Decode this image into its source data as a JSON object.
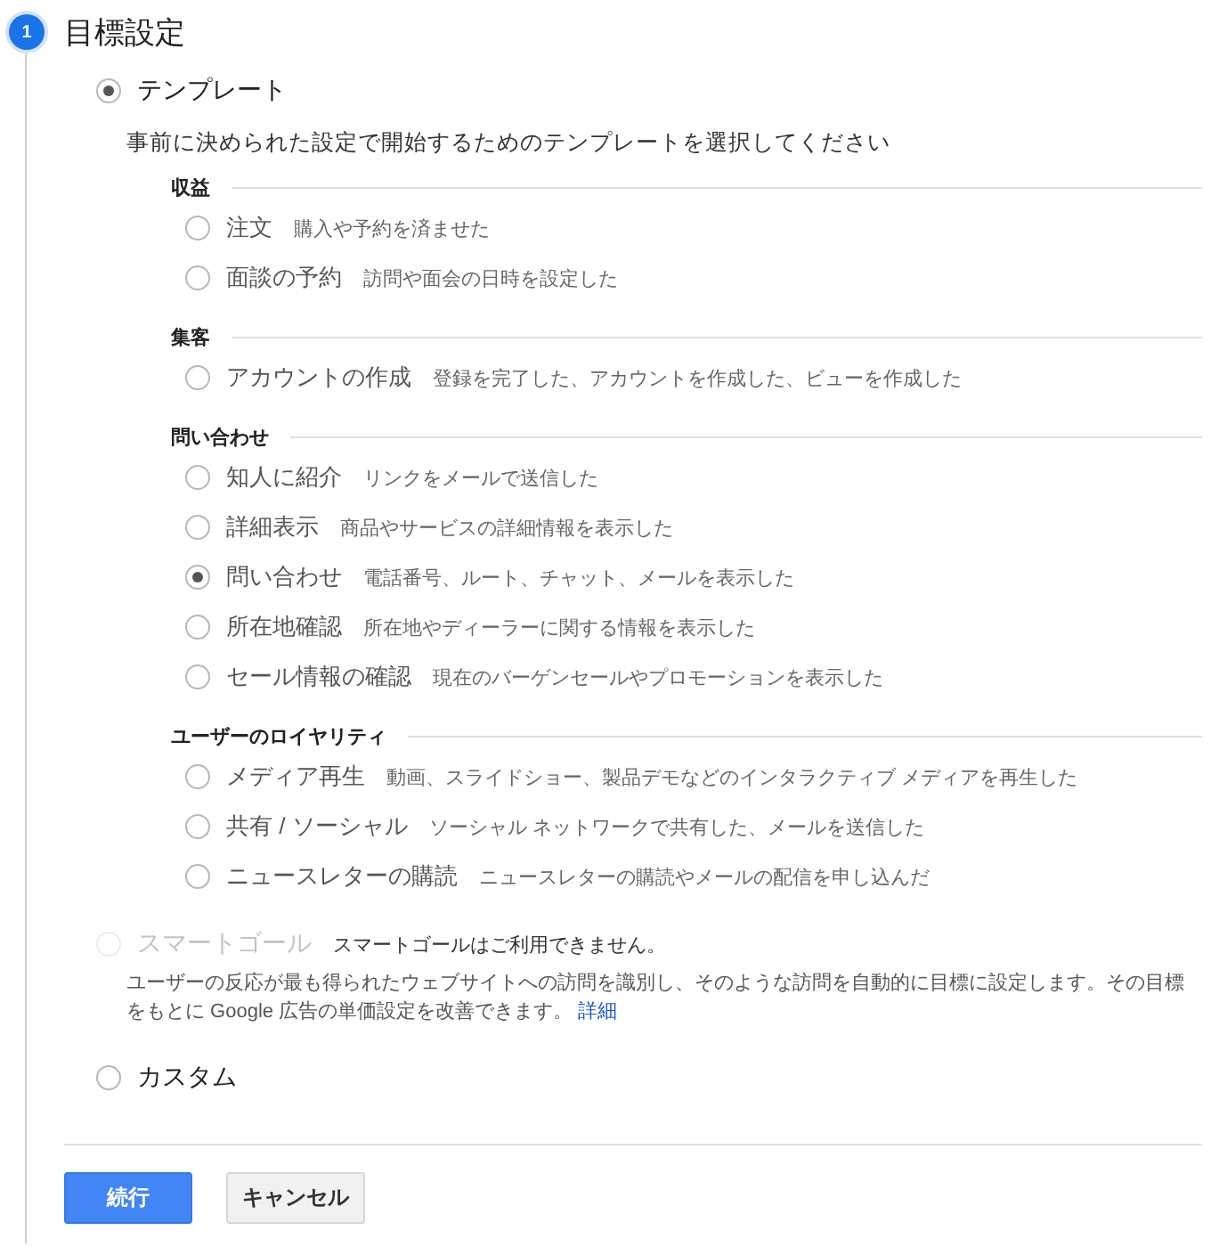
{
  "step": {
    "number": "1",
    "title": "目標設定"
  },
  "options": [
    {
      "kind": "template",
      "label": "テンプレート",
      "selected": true,
      "disabled": false,
      "description": "事前に決められた設定で開始するためのテンプレートを選択してください",
      "groups": [
        {
          "heading": "収益",
          "items": [
            {
              "label": "注文",
              "description": "購入や予約を済ませた",
              "selected": false
            },
            {
              "label": "面談の予約",
              "description": "訪問や面会の日時を設定した",
              "selected": false
            }
          ]
        },
        {
          "heading": "集客",
          "items": [
            {
              "label": "アカウントの作成",
              "description": "登録を完了した、アカウントを作成した、ビューを作成した",
              "selected": false
            }
          ]
        },
        {
          "heading": "問い合わせ",
          "items": [
            {
              "label": "知人に紹介",
              "description": "リンクをメールで送信した",
              "selected": false
            },
            {
              "label": "詳細表示",
              "description": "商品やサービスの詳細情報を表示した",
              "selected": false
            },
            {
              "label": "問い合わせ",
              "description": "電話番号、ルート、チャット、メールを表示した",
              "selected": true
            },
            {
              "label": "所在地確認",
              "description": "所在地やディーラーに関する情報を表示した",
              "selected": false
            },
            {
              "label": "セール情報の確認",
              "description": "現在のバーゲンセールやプロモーションを表示した",
              "selected": false
            }
          ]
        },
        {
          "heading": "ユーザーのロイヤリティ",
          "items": [
            {
              "label": "メディア再生",
              "description": "動画、スライドショー、製品デモなどのインタラクティブ メディアを再生した",
              "selected": false
            },
            {
              "label": "共有 / ソーシャル",
              "description": "ソーシャル ネットワークで共有した、メールを送信した",
              "selected": false
            },
            {
              "label": "ニュースレターの購読",
              "description": "ニュースレターの購読やメールの配信を申し込んだ",
              "selected": false
            }
          ]
        }
      ]
    },
    {
      "kind": "smart",
      "label": "スマートゴール",
      "note": "スマートゴールはご利用できません。",
      "selected": false,
      "disabled": true,
      "description": "ユーザーの反応が最も得られたウェブサイトへの訪問を識別し、そのような訪問を自動的に目標に設定します。その目標をもとに Google 広告の単価設定を改善できます。",
      "link": "詳細"
    },
    {
      "kind": "custom",
      "label": "カスタム",
      "selected": false,
      "disabled": false
    }
  ],
  "buttons": [
    {
      "label": "続行",
      "kind": "primary"
    },
    {
      "label": "キャンセル",
      "kind": "secondary"
    }
  ]
}
